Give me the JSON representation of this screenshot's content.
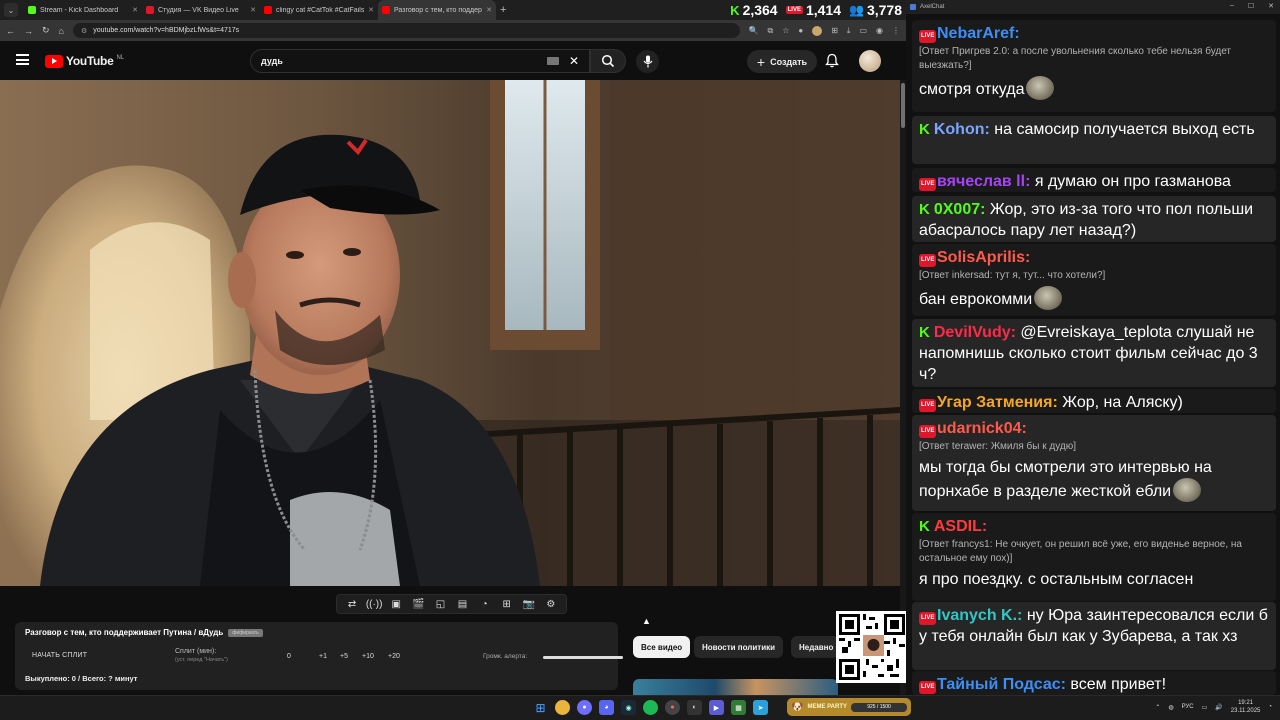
{
  "browser": {
    "tabs": [
      {
        "title": "Stream - Kick Dashboard",
        "color": "#53fc18",
        "active": false
      },
      {
        "title": "Студия — VK Видео Live",
        "color": "#e0162b",
        "active": false
      },
      {
        "title": "clingy cat #CatTok #CatFails20...",
        "color": "#ff0000",
        "active": false
      },
      {
        "title": "Разговор с тем, кто поддержив...",
        "color": "#ff0000",
        "active": true
      }
    ],
    "url": "youtube.com/watch?v=hBDMjbzLfWs&t=4717s"
  },
  "stream_stats": {
    "kick": "2,364",
    "vk": "1,414",
    "tg": "3,778"
  },
  "youtube": {
    "logo_text": "YouTube",
    "region": "NL",
    "search_query": "дудь",
    "create_label": "Создать"
  },
  "split": {
    "title": "Разговор с тем, кто поддерживает Путина / вДудь",
    "badge": "фифиркать",
    "start_label": "НАЧАТЬ СПЛИТ",
    "split_label": "Сплит (мин):",
    "split_hint": "(уст. перед \"Начать\")",
    "buttons": [
      "0",
      "+1",
      "+5",
      "+10",
      "+20"
    ],
    "volume_label": "Громк. алерта:",
    "volume_level": 1.0,
    "footer": "Выкуплено: 0 / Всего: ? минут"
  },
  "chips": [
    "Все видео",
    "Новости политики",
    "Недавно"
  ],
  "chat": {
    "window_title": "AxelChat",
    "messages": [
      {
        "platform": "vk",
        "name": "NebarAref:",
        "color": "#3d8ef5",
        "reply": "[Ответ Пригрев 2.0: а после увольнения сколько тебе нельзя будет выезжать?]",
        "text": "смотря откуда",
        "emote": true
      },
      {
        "platform": "kick",
        "name": "Kohon:",
        "color": "#7aa6ff",
        "reply": "",
        "text": "на самосир получается выход есть",
        "emote": false
      },
      {
        "platform": "vk",
        "name": "вячеслав ll:",
        "color": "#a543f5",
        "reply": "",
        "text": "я думаю он про газманова",
        "emote": false
      },
      {
        "platform": "kick",
        "name": "0X007:",
        "color": "#53fc18",
        "reply": "",
        "text": "Жор, это из-за того что пол польши абасралось пару лет назад?)",
        "emote": false
      },
      {
        "platform": "vk",
        "name": "SolisAprilis:",
        "color": "#ff5a4b",
        "reply": "[Ответ inkersad: тут я, тут... что хотели?]",
        "text": "бан еврокомми",
        "emote": true
      },
      {
        "platform": "kick",
        "name": "DevilVudy:",
        "color": "#ff2a4a",
        "reply": "",
        "text": "@Evreiskaya_teplota слушай не напомнишь сколько стоит фильм сейчас до 3 ч?",
        "emote": false
      },
      {
        "platform": "vk",
        "name": "Угар Затмения:",
        "color": "#f5a623",
        "reply": "",
        "text": "Жор, на Аляску)",
        "emote": false
      },
      {
        "platform": "vk",
        "name": "udarnick04:",
        "color": "#ff5a4b",
        "reply": "[Ответ terawer: Жмиля бы к дудю]",
        "text": "мы тогда бы смотрели это интервью на порнхабе в разделе жесткой ебли",
        "emote": true
      },
      {
        "platform": "kick",
        "name": "ASDIL:",
        "color": "#ff3b3b",
        "reply": "[Ответ francys1: Не очкует, он решил всё уже, его виденье верное, на остальное ему пох)]",
        "text": "я про поездку. с остальным согласен",
        "emote": false
      },
      {
        "platform": "vk",
        "name": "Ivanych K.:",
        "color": "#34c6c6",
        "reply": "",
        "text": "ну Юра заинтересовался если б у тебя онлайн был как у Зубарева, а так хз",
        "emote": false
      },
      {
        "platform": "vk",
        "name": "Тайный Подсас:",
        "color": "#3d8ef5",
        "reply": "",
        "text": "всем привет!",
        "emote": false
      }
    ]
  },
  "taskbar": {
    "party_label": "MEME PARTY",
    "party_progress": "925 / 1500",
    "lang": "РУС",
    "time": "19:21",
    "date": "23.11.2025"
  }
}
